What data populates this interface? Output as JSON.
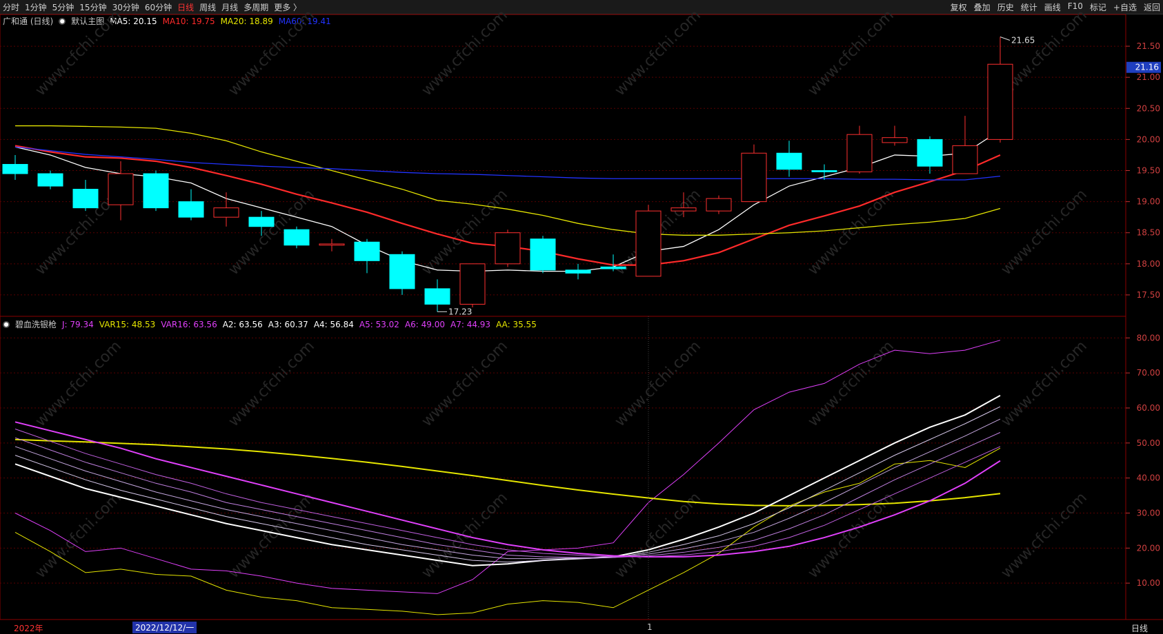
{
  "toolbar": {
    "periods": [
      "分时",
      "1分钟",
      "5分钟",
      "15分钟",
      "30分钟",
      "60分钟",
      "日线",
      "周线",
      "月线",
      "多周期",
      "更多 〉"
    ],
    "active_period": "日线",
    "actions": [
      "复权",
      "叠加",
      "历史",
      "统计",
      "画线",
      "F10",
      "标记",
      "+自选",
      "返回"
    ]
  },
  "main_legend": {
    "security": "广和通 (日线)",
    "template": "默认主图",
    "items": [
      {
        "label": "MA5: 20.15",
        "color": "#ffffff"
      },
      {
        "label": "MA10: 19.75",
        "color": "#ff2a2a"
      },
      {
        "label": "MA20: 18.89",
        "color": "#e6e600"
      },
      {
        "label": "MA60: 19.41",
        "color": "#2233ff"
      }
    ]
  },
  "sub_legend": {
    "name": "碧血洗银枪",
    "items": [
      {
        "label": "J: 79.34",
        "color": "#e040fb"
      },
      {
        "label": "VAR15: 48.53",
        "color": "#e6e600"
      },
      {
        "label": "VAR16: 63.56",
        "color": "#e040fb"
      },
      {
        "label": "A2: 63.56",
        "color": "#ffffff"
      },
      {
        "label": "A3: 60.37",
        "color": "#ffffff"
      },
      {
        "label": "A4: 56.84",
        "color": "#ffffff"
      },
      {
        "label": "A5: 53.02",
        "color": "#e040fb"
      },
      {
        "label": "A6: 49.00",
        "color": "#e040fb"
      },
      {
        "label": "A7: 44.93",
        "color": "#e040fb"
      },
      {
        "label": "AA: 35.55",
        "color": "#e6e600"
      }
    ]
  },
  "bottom_bar": {
    "year": "2022年",
    "cursor_date": "2022/12/12/一",
    "month_mark": "1",
    "period": "日线"
  },
  "watermark": "www.cfchi.com",
  "chart_data": [
    {
      "type": "candlestick",
      "current_price": "21.16",
      "high_label": "21.65",
      "low_label": "17.23",
      "ylim": [
        17.2,
        21.8
      ],
      "yticks": [
        17.5,
        18.0,
        18.5,
        19.0,
        19.5,
        20.0,
        20.5,
        21.0,
        21.5
      ],
      "candles": [
        {
          "o": 19.6,
          "c": 19.45,
          "h": 19.75,
          "l": 19.35
        },
        {
          "o": 19.45,
          "c": 19.25,
          "h": 19.5,
          "l": 19.2
        },
        {
          "o": 19.2,
          "c": 18.9,
          "h": 19.35,
          "l": 18.85
        },
        {
          "o": 18.95,
          "c": 19.45,
          "h": 19.65,
          "l": 18.7
        },
        {
          "o": 19.45,
          "c": 18.9,
          "h": 19.5,
          "l": 18.85
        },
        {
          "o": 19.0,
          "c": 18.75,
          "h": 19.2,
          "l": 18.7
        },
        {
          "o": 18.75,
          "c": 18.9,
          "h": 19.15,
          "l": 18.6
        },
        {
          "o": 18.75,
          "c": 18.6,
          "h": 18.85,
          "l": 18.45
        },
        {
          "o": 18.55,
          "c": 18.3,
          "h": 18.6,
          "l": 18.25
        },
        {
          "o": 18.3,
          "c": 18.32,
          "h": 18.4,
          "l": 18.2
        },
        {
          "o": 18.35,
          "c": 18.05,
          "h": 18.4,
          "l": 17.85
        },
        {
          "o": 18.15,
          "c": 17.6,
          "h": 18.2,
          "l": 17.5
        },
        {
          "o": 17.6,
          "c": 17.35,
          "h": 17.75,
          "l": 17.23
        },
        {
          "o": 17.35,
          "c": 18.0,
          "h": 18.0,
          "l": 17.3
        },
        {
          "o": 18.0,
          "c": 18.5,
          "h": 18.55,
          "l": 17.95
        },
        {
          "o": 18.4,
          "c": 17.9,
          "h": 18.45,
          "l": 17.85
        },
        {
          "o": 17.9,
          "c": 17.85,
          "h": 18.0,
          "l": 17.75
        },
        {
          "o": 17.95,
          "c": 17.92,
          "h": 18.15,
          "l": 17.88
        },
        {
          "o": 17.8,
          "c": 18.85,
          "h": 18.95,
          "l": 17.8
        },
        {
          "o": 18.85,
          "c": 18.9,
          "h": 19.15,
          "l": 18.75
        },
        {
          "o": 18.85,
          "c": 19.05,
          "h": 19.1,
          "l": 18.8
        },
        {
          "o": 19.0,
          "c": 19.78,
          "h": 19.92,
          "l": 19.0
        },
        {
          "o": 19.78,
          "c": 19.52,
          "h": 19.98,
          "l": 19.4
        },
        {
          "o": 19.5,
          "c": 19.48,
          "h": 19.6,
          "l": 19.35
        },
        {
          "o": 19.48,
          "c": 20.08,
          "h": 20.22,
          "l": 19.45
        },
        {
          "o": 19.95,
          "c": 20.03,
          "h": 20.22,
          "l": 19.9
        },
        {
          "o": 20.0,
          "c": 19.57,
          "h": 20.05,
          "l": 19.45
        },
        {
          "o": 19.45,
          "c": 19.9,
          "h": 20.38,
          "l": 19.45
        },
        {
          "o": 20.0,
          "c": 21.21,
          "h": 21.65,
          "l": 19.95
        }
      ],
      "series": [
        {
          "name": "MA5",
          "color": "#ffffff",
          "values": [
            19.88,
            19.75,
            19.55,
            19.45,
            19.4,
            19.3,
            19.05,
            18.9,
            18.75,
            18.6,
            18.3,
            18.05,
            17.9,
            17.88,
            17.9,
            17.88,
            17.88,
            17.95,
            18.2,
            18.28,
            18.55,
            18.95,
            19.25,
            19.4,
            19.55,
            19.75,
            19.73,
            19.78,
            20.15
          ]
        },
        {
          "name": "MA10",
          "color": "#ff2a2a",
          "values": [
            19.9,
            19.8,
            19.72,
            19.7,
            19.65,
            19.55,
            19.42,
            19.28,
            19.12,
            18.98,
            18.83,
            18.65,
            18.48,
            18.33,
            18.28,
            18.2,
            18.08,
            17.98,
            17.98,
            18.05,
            18.18,
            18.4,
            18.62,
            18.77,
            18.93,
            19.15,
            19.32,
            19.5,
            19.75
          ]
        },
        {
          "name": "MA20",
          "color": "#e6e600",
          "values": [
            20.22,
            20.22,
            20.21,
            20.2,
            20.18,
            20.1,
            19.98,
            19.8,
            19.65,
            19.5,
            19.35,
            19.2,
            19.02,
            18.96,
            18.88,
            18.78,
            18.65,
            18.55,
            18.48,
            18.46,
            18.46,
            18.48,
            18.5,
            18.53,
            18.58,
            18.63,
            18.67,
            18.73,
            18.89
          ]
        },
        {
          "name": "MA60",
          "color": "#2233ff",
          "values": [
            19.88,
            19.82,
            19.76,
            19.72,
            19.68,
            19.63,
            19.6,
            19.57,
            19.55,
            19.53,
            19.5,
            19.47,
            19.45,
            19.44,
            19.42,
            19.4,
            19.38,
            19.37,
            19.37,
            19.37,
            19.37,
            19.37,
            19.37,
            19.37,
            19.36,
            19.36,
            19.35,
            19.35,
            19.41
          ]
        }
      ]
    },
    {
      "type": "line",
      "title": "碧血洗银枪",
      "ylim": [
        0,
        84
      ],
      "yticks": [
        10,
        20,
        30,
        40,
        50,
        60,
        70,
        80
      ],
      "series": [
        {
          "name": "J",
          "color": "#e040fb",
          "width": 1,
          "values": [
            30,
            25,
            19,
            20,
            17,
            14,
            13.5,
            12,
            10,
            8.5,
            8,
            7.5,
            7,
            11,
            19,
            19.5,
            20,
            21.5,
            33,
            41,
            50,
            59.5,
            64.5,
            67,
            72.5,
            76.5,
            75.5,
            76.5,
            79.34
          ]
        },
        {
          "name": "VAR15",
          "color": "#e6e600",
          "width": 1,
          "values": [
            24.5,
            19,
            13,
            14,
            12.5,
            12,
            8,
            6,
            5,
            3,
            2.5,
            2,
            1,
            1.5,
            4,
            5,
            4.5,
            3,
            8,
            13,
            18.5,
            26,
            32,
            36,
            38.5,
            44,
            45,
            43,
            48.53
          ]
        },
        {
          "name": "AA",
          "color": "#e6e600",
          "width": 2,
          "values": [
            51,
            50.6,
            50.3,
            49.9,
            49.5,
            48.9,
            48.3,
            47.5,
            46.6,
            45.6,
            44.5,
            43.3,
            42.0,
            40.7,
            39.3,
            37.9,
            36.6,
            35.4,
            34.3,
            33.3,
            32.6,
            32.2,
            32.1,
            32.2,
            32.4,
            32.8,
            33.5,
            34.4,
            35.55
          ]
        },
        {
          "name": "A2",
          "color": "#ffffff",
          "width": 2,
          "values": [
            44,
            40.5,
            37,
            34.5,
            32,
            29.5,
            27,
            25,
            23,
            21,
            19.5,
            18,
            16.5,
            15,
            15.5,
            16.5,
            17,
            17.5,
            19.5,
            22.5,
            26,
            30,
            35,
            40,
            45,
            50,
            54.5,
            58,
            63.56
          ]
        },
        {
          "name": "A3",
          "color": "#d6c8ea",
          "width": 1,
          "values": [
            46.5,
            43,
            39.5,
            36.5,
            34,
            31.5,
            29,
            27,
            25,
            23,
            21,
            19.5,
            18,
            16.5,
            16,
            16.5,
            17,
            17.3,
            18.8,
            21,
            23.5,
            27,
            31.5,
            36.5,
            41.5,
            46.5,
            51,
            55.5,
            60.37
          ]
        },
        {
          "name": "A4",
          "color": "#c6a8e0",
          "width": 1,
          "values": [
            49,
            45.5,
            42,
            39,
            36,
            33.5,
            31,
            29,
            27,
            25,
            23,
            21,
            19.5,
            18,
            17,
            17,
            17.2,
            17.3,
            18.3,
            19.8,
            21.8,
            24.5,
            28.5,
            33,
            38,
            43,
            47.5,
            52,
            56.84
          ]
        },
        {
          "name": "A5",
          "color": "#c080e0",
          "width": 1,
          "values": [
            51.5,
            48,
            44.5,
            41.5,
            38.5,
            36,
            33,
            31,
            29,
            27,
            25,
            23,
            21,
            19.5,
            18,
            17.5,
            17.3,
            17.3,
            17.8,
            18.8,
            20.2,
            22.2,
            25.5,
            29.5,
            34.5,
            39.5,
            44,
            48.5,
            53.02
          ]
        },
        {
          "name": "A6",
          "color": "#c060e0",
          "width": 1,
          "values": [
            54,
            50.5,
            47,
            44,
            41,
            38.5,
            35.5,
            33,
            31,
            29,
            27,
            25,
            23,
            21,
            19.5,
            18.5,
            18,
            17.5,
            17.5,
            18,
            19,
            20.5,
            23,
            26.5,
            31,
            35.5,
            40,
            44.5,
            49.0
          ]
        },
        {
          "name": "A7",
          "color": "#e040fb",
          "width": 2,
          "values": [
            56,
            53.5,
            51,
            48.5,
            45.5,
            43,
            40.5,
            38,
            35.5,
            33,
            30.5,
            28,
            25.5,
            23,
            21,
            19.5,
            18.5,
            17.8,
            17.5,
            17.5,
            18,
            19,
            20.5,
            23,
            26,
            29.5,
            33.5,
            38.5,
            44.93
          ]
        }
      ]
    }
  ]
}
